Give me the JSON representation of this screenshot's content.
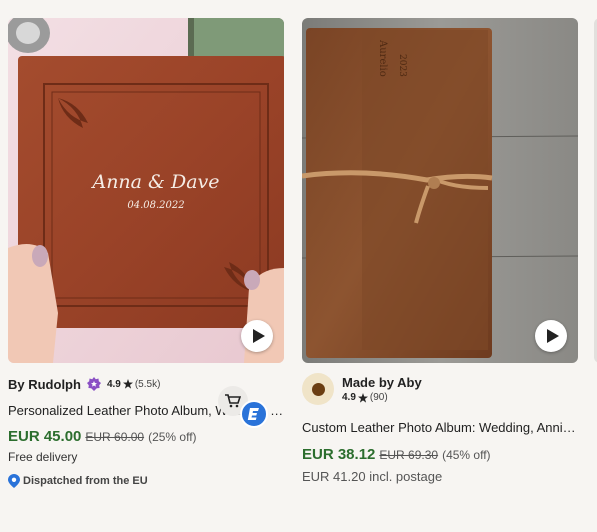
{
  "colors": {
    "price_green": "#2c6e2e",
    "badge_purple": "#8a4fc4",
    "dispatch_blue": "#2a73d9"
  },
  "listings": [
    {
      "seller": "By Rudolph",
      "seller_badge_icon": "star-seller-icon",
      "rating": "4.9",
      "reviews": "(5.5k)",
      "title": "Personalized Leather Photo Album, Wedding Photo Album",
      "image_text": {
        "names": "Anna & Dave",
        "date": "04.08.2022"
      },
      "price": "EUR 45.00",
      "original_price": "EUR 60.00",
      "discount": "(25% off)",
      "shipping": "Free delivery",
      "dispatch": "Dispatched from the EU"
    },
    {
      "seller": "Made by Aby",
      "rating": "4.9",
      "reviews": "(90)",
      "title": "Custom Leather Photo Album: Wedding, Anniversary Gift",
      "image_text": {
        "names": "Aurelio",
        "year": "2023"
      },
      "price": "EUR 38.12",
      "original_price": "EUR 69.30",
      "discount": "(45% off)",
      "shipping": "EUR 41.20 incl. postage"
    }
  ]
}
